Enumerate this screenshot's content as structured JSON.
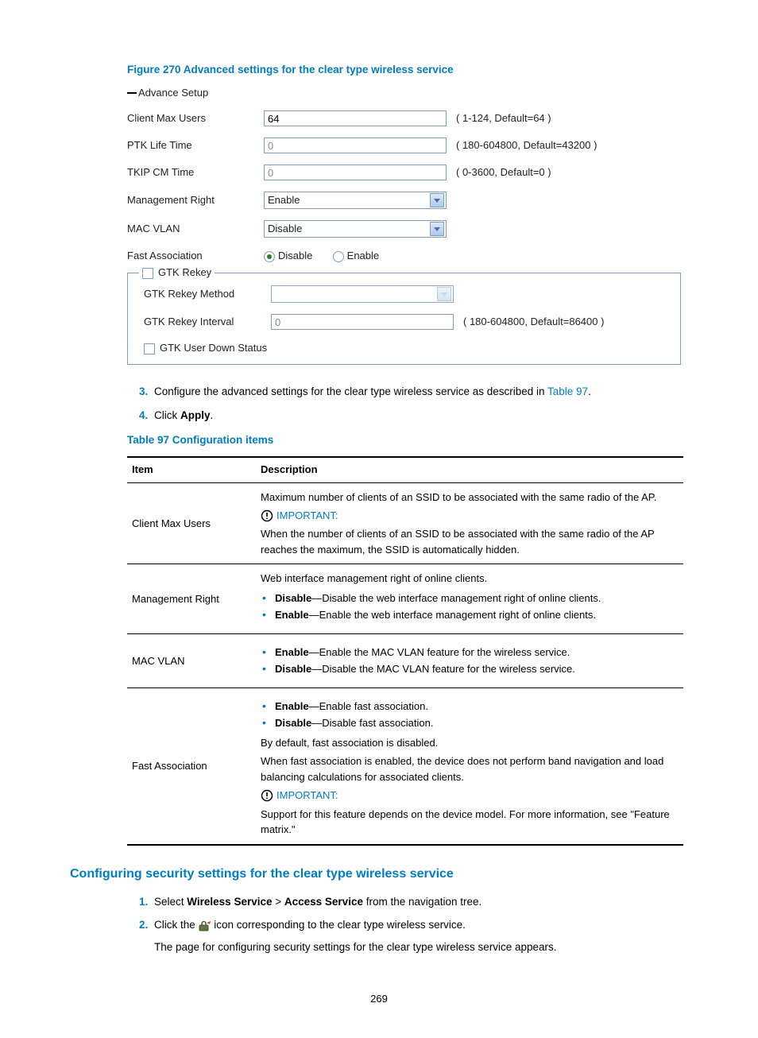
{
  "figure": {
    "caption": "Figure 270 Advanced settings for the clear type wireless service",
    "panel_title": "Advance Setup",
    "rows": {
      "client_max_users": {
        "label": "Client Max Users",
        "value": "64",
        "hint": "( 1-124, Default=64 )"
      },
      "ptk_life_time": {
        "label": "PTK Life Time",
        "value": "0",
        "hint": "( 180-604800, Default=43200 )"
      },
      "tkip_cm_time": {
        "label": "TKIP CM Time",
        "value": "0",
        "hint": "( 0-3600, Default=0 )"
      },
      "mgmt_right": {
        "label": "Management Right",
        "value": "Enable"
      },
      "mac_vlan": {
        "label": "MAC VLAN",
        "value": "Disable"
      },
      "fast_assoc": {
        "label": "Fast Association",
        "opt_disable": "Disable",
        "opt_enable": "Enable"
      },
      "gtk_rekey_legend": "GTK Rekey",
      "gtk_method": {
        "label": "GTK Rekey Method",
        "value": ""
      },
      "gtk_interval": {
        "label": "GTK Rekey Interval",
        "value": "0",
        "hint": "( 180-604800, Default=86400 )"
      },
      "gtk_user_down": {
        "label": "GTK User Down Status"
      }
    }
  },
  "steps1": {
    "s3_pre": "Configure the advanced settings for the clear type wireless service as described in ",
    "s3_link": "Table 97",
    "s3_post": ".",
    "s4_pre": "Click ",
    "s4_bold": "Apply",
    "s4_post": "."
  },
  "table": {
    "caption": "Table 97 Configuration items",
    "head_item": "Item",
    "head_desc": "Description",
    "r1": {
      "item": "Client Max Users",
      "line1": "Maximum number of clients of an SSID to be associated with the same radio of the AP.",
      "important": "IMPORTANT:",
      "line2": "When the number of clients of an SSID to be associated with the same radio of the AP reaches the maximum, the SSID is automatically hidden."
    },
    "r2": {
      "item": "Management Right",
      "line1": "Web interface management right of online clients.",
      "b1_bold": "Disable",
      "b1_rest": "—Disable the web interface management right of online clients.",
      "b2_bold": "Enable",
      "b2_rest": "—Enable the web interface management right of online clients."
    },
    "r3": {
      "item": "MAC VLAN",
      "b1_bold": "Enable",
      "b1_rest": "—Enable the MAC VLAN feature for the wireless service.",
      "b2_bold": "Disable",
      "b2_rest": "—Disable the MAC VLAN feature for the wireless service."
    },
    "r4": {
      "item": "Fast Association",
      "b1_bold": "Enable",
      "b1_rest": "—Enable fast association.",
      "b2_bold": "Disable",
      "b2_rest": "—Disable fast association.",
      "line2": "By default, fast association is disabled.",
      "line3": "When fast association is enabled, the device does not perform band navigation and load balancing calculations for associated clients.",
      "important": "IMPORTANT:",
      "line4": "Support for this feature depends on the device model. For more information, see \"Feature matrix.\""
    }
  },
  "section2": {
    "heading": "Configuring security settings for the clear type wireless service",
    "s1_pre": "Select ",
    "s1_b1": "Wireless Service",
    "s1_gt": " > ",
    "s1_b2": "Access Service",
    "s1_post": " from the navigation tree.",
    "s2_pre": "Click the ",
    "s2_post": " icon corresponding to the clear type wireless service.",
    "s2_cont": "The page for configuring security settings for the clear type wireless service appears."
  },
  "page_number": "269"
}
